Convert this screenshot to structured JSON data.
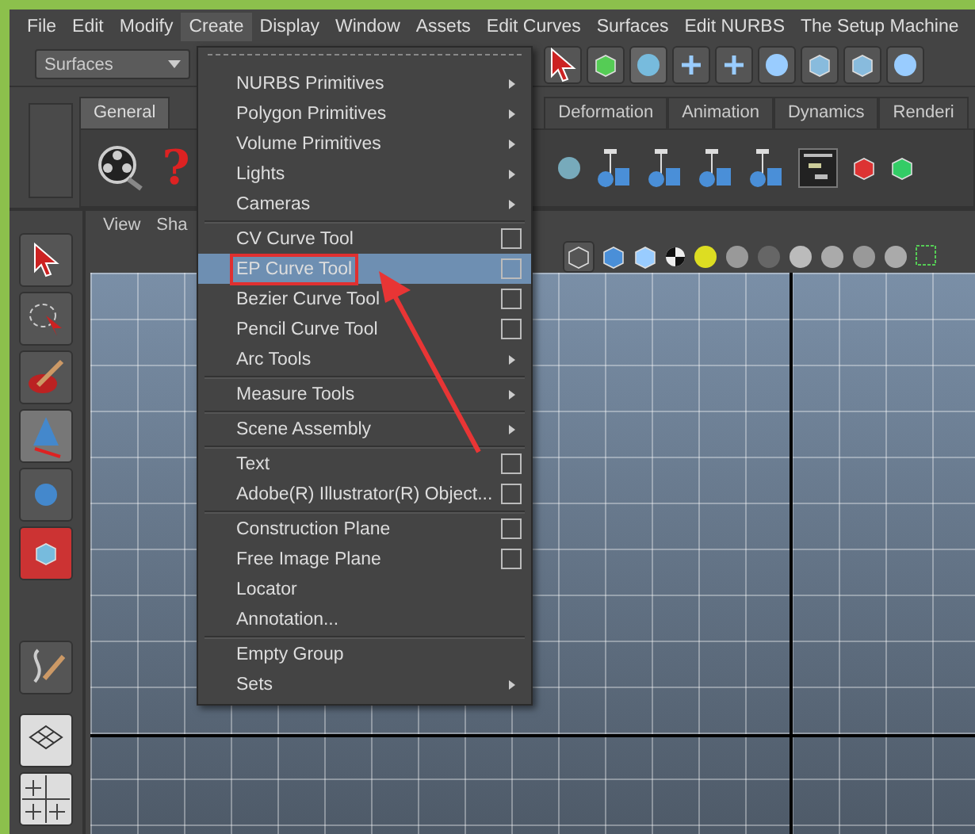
{
  "menu_bar": [
    {
      "label": "File",
      "selected": false
    },
    {
      "label": "Edit",
      "selected": false
    },
    {
      "label": "Modify",
      "selected": false
    },
    {
      "label": "Create",
      "selected": true
    },
    {
      "label": "Display",
      "selected": false
    },
    {
      "label": "Window",
      "selected": false
    },
    {
      "label": "Assets",
      "selected": false
    },
    {
      "label": "Edit Curves",
      "selected": false
    },
    {
      "label": "Surfaces",
      "selected": false
    },
    {
      "label": "Edit NURBS",
      "selected": false
    },
    {
      "label": "The Setup Machine",
      "selected": false
    }
  ],
  "menu_set": {
    "value": "Surfaces"
  },
  "shelf": {
    "tabs": [
      {
        "label": "General",
        "selected": true
      },
      {
        "label": "Deformation",
        "selected": false
      },
      {
        "label": "Animation",
        "selected": false
      },
      {
        "label": "Dynamics",
        "selected": false
      },
      {
        "label": "Renderi",
        "selected": false
      }
    ],
    "help_glyph": "?"
  },
  "viewport": {
    "panel_menu": [
      "View",
      "Sha"
    ]
  },
  "create_menu": {
    "groups": [
      {
        "items": [
          {
            "label": "NURBS Primitives",
            "submenu": true,
            "option_box": false,
            "selected": false,
            "annotated": false
          },
          {
            "label": "Polygon Primitives",
            "submenu": true,
            "option_box": false,
            "selected": false,
            "annotated": false
          },
          {
            "label": "Volume Primitives",
            "submenu": true,
            "option_box": false,
            "selected": false,
            "annotated": false
          },
          {
            "label": "Lights",
            "submenu": true,
            "option_box": false,
            "selected": false,
            "annotated": false
          },
          {
            "label": "Cameras",
            "submenu": true,
            "option_box": false,
            "selected": false,
            "annotated": false
          }
        ]
      },
      {
        "items": [
          {
            "label": "CV Curve Tool",
            "submenu": false,
            "option_box": true,
            "selected": false,
            "annotated": false
          },
          {
            "label": "EP Curve Tool",
            "submenu": false,
            "option_box": true,
            "selected": true,
            "annotated": true
          },
          {
            "label": "Bezier Curve Tool",
            "submenu": false,
            "option_box": true,
            "selected": false,
            "annotated": false
          },
          {
            "label": "Pencil Curve Tool",
            "submenu": false,
            "option_box": true,
            "selected": false,
            "annotated": false
          },
          {
            "label": "Arc Tools",
            "submenu": true,
            "option_box": false,
            "selected": false,
            "annotated": false
          }
        ]
      },
      {
        "items": [
          {
            "label": "Measure Tools",
            "submenu": true,
            "option_box": false,
            "selected": false,
            "annotated": false
          }
        ]
      },
      {
        "items": [
          {
            "label": "Scene Assembly",
            "submenu": true,
            "option_box": false,
            "selected": false,
            "annotated": false
          }
        ]
      },
      {
        "items": [
          {
            "label": "Text",
            "submenu": false,
            "option_box": true,
            "selected": false,
            "annotated": false
          },
          {
            "label": "Adobe(R) Illustrator(R) Object...",
            "submenu": false,
            "option_box": true,
            "selected": false,
            "annotated": false
          }
        ]
      },
      {
        "items": [
          {
            "label": "Construction Plane",
            "submenu": false,
            "option_box": true,
            "selected": false,
            "annotated": false
          },
          {
            "label": "Free Image Plane",
            "submenu": false,
            "option_box": true,
            "selected": false,
            "annotated": false
          },
          {
            "label": "Locator",
            "submenu": false,
            "option_box": false,
            "selected": false,
            "annotated": false
          },
          {
            "label": "Annotation...",
            "submenu": false,
            "option_box": false,
            "selected": false,
            "annotated": false
          }
        ]
      },
      {
        "items": [
          {
            "label": "Empty Group",
            "submenu": false,
            "option_box": false,
            "selected": false,
            "annotated": false
          },
          {
            "label": "Sets",
            "submenu": true,
            "option_box": false,
            "selected": false,
            "annotated": false
          }
        ]
      }
    ]
  }
}
